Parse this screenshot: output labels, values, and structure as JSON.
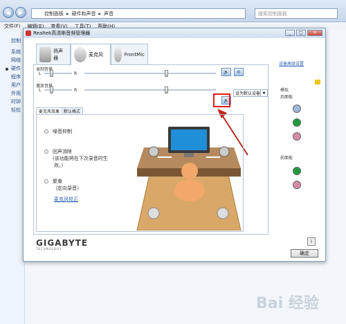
{
  "explorer": {
    "address_parts": [
      "控制面板",
      "硬件和声音",
      "声音"
    ],
    "search_placeholder": "搜索控制面板",
    "menu": [
      "文件(F)",
      "编辑(E)",
      "查看(V)",
      "工具(T)",
      "帮助(H)"
    ],
    "left_items": [
      "控制",
      "系统",
      "网络",
      "硬件",
      "程序",
      "用户",
      "外观",
      "时钟",
      "轻松"
    ],
    "watermark": "Bai 经验"
  },
  "dialog": {
    "title": "Realtek高清晰音频管理器",
    "device_tabs": [
      "扬声器",
      "麦克风",
      "FrontMic"
    ],
    "recording_volume_label": "录制音量",
    "playback_volume_label": "播放音量",
    "left_label": "L",
    "right_label": "R",
    "default_device": "设为默认设备",
    "recording_volume_level": 0.62,
    "recording_balance_level": 0.25,
    "playback_volume_level": 0.62,
    "playback_balance_level": 0.25,
    "inner_tabs": [
      "麦克风效果",
      "默认格式"
    ],
    "options": {
      "noise": "噪音抑制",
      "echo_line1": "回声消除",
      "echo_line2": "(该功能将在下次录音时生",
      "echo_line3": "效。)",
      "beam_line1": "聚束",
      "beam_line2": "（定向录音）",
      "calibration": "麦克风校正"
    },
    "right_pane": {
      "settings_link": "设备高级设置",
      "analog": "模拟",
      "back_panel": "后面板",
      "front_panel": "前面板"
    },
    "brand": "GIGABYTE",
    "brand_sub": "TECHNOLOGY",
    "ok": "确定",
    "info_icon": "i"
  }
}
